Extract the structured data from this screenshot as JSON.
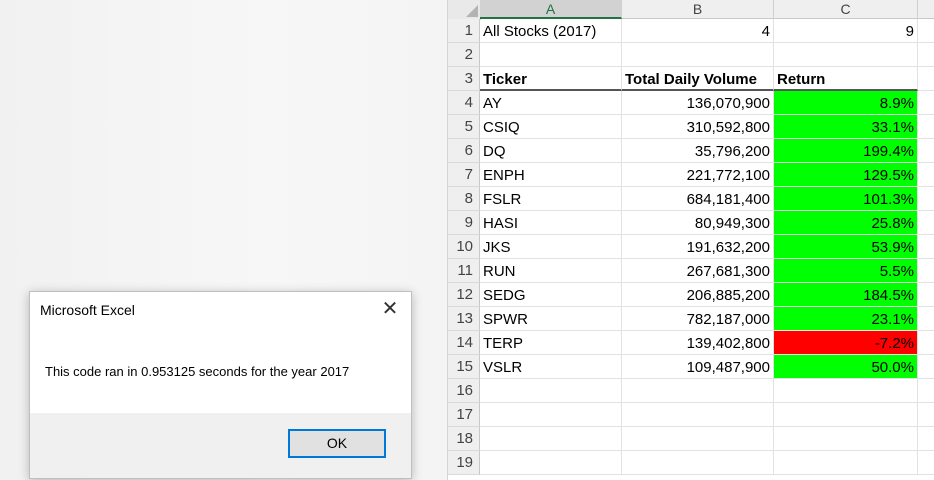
{
  "dialog": {
    "title": "Microsoft Excel",
    "close_glyph": "✕",
    "message": "This code ran in 0.953125 seconds for the year 2017",
    "ok_label": "OK"
  },
  "sheet": {
    "columns": [
      "A",
      "B",
      "C"
    ],
    "row_numbers": [
      "1",
      "2",
      "3",
      "4",
      "5",
      "6",
      "7",
      "8",
      "9",
      "10",
      "11",
      "12",
      "13",
      "14",
      "15",
      "16",
      "17",
      "18",
      "19"
    ],
    "title_row": {
      "a": "All Stocks (2017)",
      "b": "4",
      "c": "9"
    },
    "headers": {
      "ticker": "Ticker",
      "volume": "Total Daily Volume",
      "return": "Return"
    },
    "rows": [
      {
        "ticker": "AY",
        "volume": "136,070,900",
        "return": "8.9%"
      },
      {
        "ticker": "CSIQ",
        "volume": "310,592,800",
        "return": "33.1%"
      },
      {
        "ticker": "DQ",
        "volume": "35,796,200",
        "return": "199.4%"
      },
      {
        "ticker": "ENPH",
        "volume": "221,772,100",
        "return": "129.5%"
      },
      {
        "ticker": "FSLR",
        "volume": "684,181,400",
        "return": "101.3%"
      },
      {
        "ticker": "HASI",
        "volume": "80,949,300",
        "return": "25.8%"
      },
      {
        "ticker": "JKS",
        "volume": "191,632,200",
        "return": "53.9%"
      },
      {
        "ticker": "RUN",
        "volume": "267,681,300",
        "return": "5.5%"
      },
      {
        "ticker": "SEDG",
        "volume": "206,885,200",
        "return": "184.5%"
      },
      {
        "ticker": "SPWR",
        "volume": "782,187,000",
        "return": "23.1%"
      },
      {
        "ticker": "TERP",
        "volume": "139,402,800",
        "return": "-7.2%"
      },
      {
        "ticker": "VSLR",
        "volume": "109,487,900",
        "return": "50.0%"
      }
    ],
    "colors": {
      "positive": "#00ff00",
      "negative": "#ff0000",
      "selected_header": "#217346"
    }
  }
}
